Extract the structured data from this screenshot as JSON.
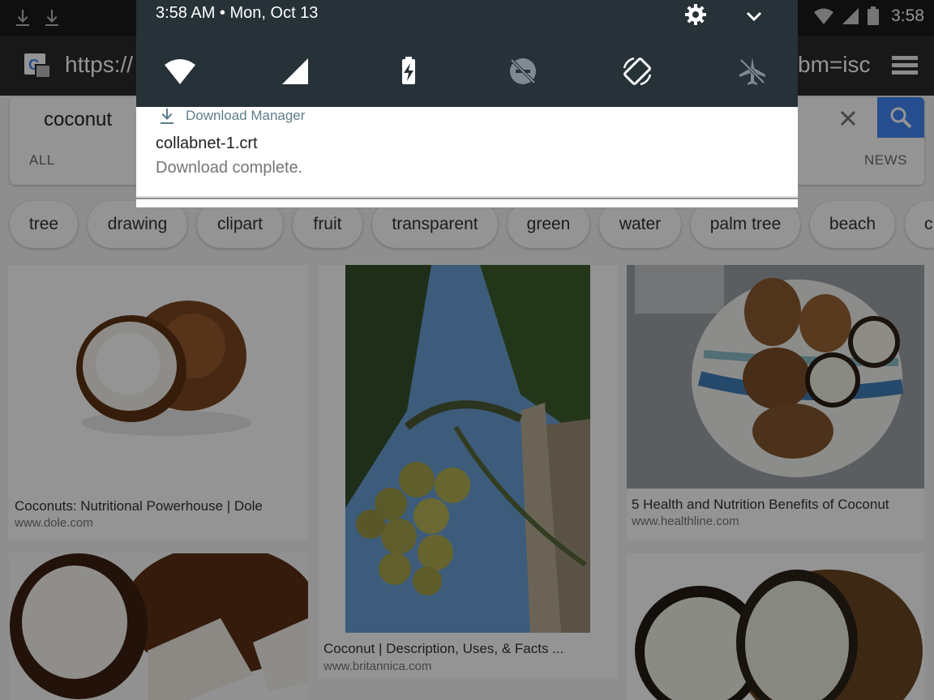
{
  "status_bar": {
    "time": "3:58"
  },
  "url_bar": {
    "url_start": "https://",
    "url_end": "bm=isc"
  },
  "search": {
    "query": "coconut",
    "tabs": [
      "ALL",
      "NEWS"
    ]
  },
  "chips": [
    "tree",
    "drawing",
    "clipart",
    "fruit",
    "transparent",
    "green",
    "water",
    "palm tree",
    "beach",
    "c"
  ],
  "results": [
    {
      "title": "Coconuts: Nutritional Powerhouse | Dole",
      "source": "www.dole.com"
    },
    {
      "title": "Coconut | Description, Uses, & Facts ...",
      "source": "www.britannica.com"
    },
    {
      "title": "5 Health and Nutrition Benefits of Coconut",
      "source": "www.healthline.com"
    }
  ],
  "shade": {
    "clock": "3:58 AM • Mon, Oct 13",
    "notification": {
      "app": "Download Manager",
      "title": "collabnet-1.crt",
      "text": "Download complete."
    }
  },
  "colors": {
    "shade_bg": "#263238",
    "search_accent": "#4285f4",
    "status_bar": "#1b1b1b"
  }
}
